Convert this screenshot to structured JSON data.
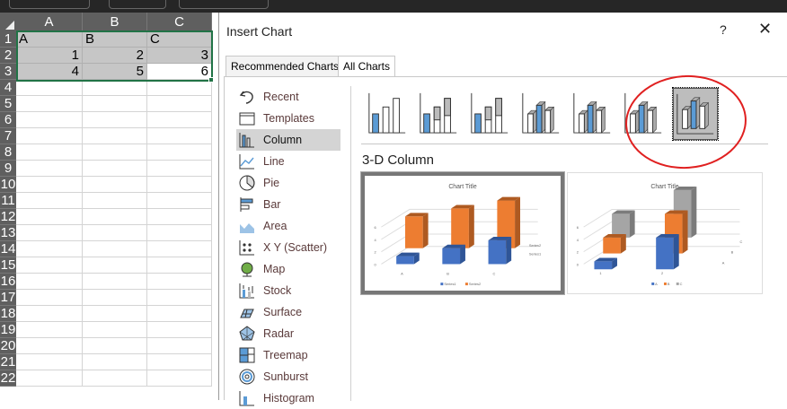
{
  "sheet": {
    "columns": [
      "A",
      "B",
      "C"
    ],
    "rows": [
      "1",
      "2",
      "3",
      "4",
      "5",
      "6",
      "7",
      "8",
      "9",
      "10",
      "11",
      "12",
      "13",
      "14",
      "15",
      "16",
      "17",
      "18",
      "19",
      "20",
      "21",
      "22"
    ],
    "cells": [
      [
        "A",
        "B",
        "C"
      ],
      [
        "1",
        "2",
        "3"
      ],
      [
        "4",
        "5",
        "6"
      ]
    ]
  },
  "dialog": {
    "title": "Insert Chart",
    "help": "?",
    "close": "✕",
    "tabs": [
      "Recommended Charts",
      "All Charts"
    ],
    "categories": [
      "Recent",
      "Templates",
      "Column",
      "Line",
      "Pie",
      "Bar",
      "Area",
      "X Y (Scatter)",
      "Map",
      "Stock",
      "Surface",
      "Radar",
      "Treemap",
      "Sunburst",
      "Histogram"
    ],
    "selected_category": "Column",
    "subtypes": [
      "clustered-column",
      "stacked-column",
      "100-stacked-column",
      "3d-clustered-column",
      "3d-stacked-column",
      "3d-100-stacked-column",
      "3d-column"
    ],
    "selected_subtype": "3d-column",
    "subtype_title": "3-D Column",
    "previews": [
      {
        "title": "Chart Title",
        "categories": [
          "A",
          "B",
          "C"
        ],
        "series": [
          {
            "name": "Series1",
            "values": [
              1,
              2,
              3
            ],
            "color": "#4472c4"
          },
          {
            "name": "Series2",
            "values": [
              4,
              5,
              6
            ],
            "color": "#ed7d31"
          }
        ],
        "yticks": [
          "0",
          "2",
          "4",
          "6"
        ]
      },
      {
        "title": "Chart Title",
        "categories": [
          "1",
          "2"
        ],
        "series": [
          {
            "name": "A",
            "values": [
              1,
              4
            ],
            "color": "#4472c4"
          },
          {
            "name": "B",
            "values": [
              2,
              5
            ],
            "color": "#ed7d31"
          },
          {
            "name": "C",
            "values": [
              3,
              6
            ],
            "color": "#a5a5a5"
          }
        ],
        "yticks": [
          "0",
          "2",
          "4",
          "6"
        ]
      }
    ]
  }
}
